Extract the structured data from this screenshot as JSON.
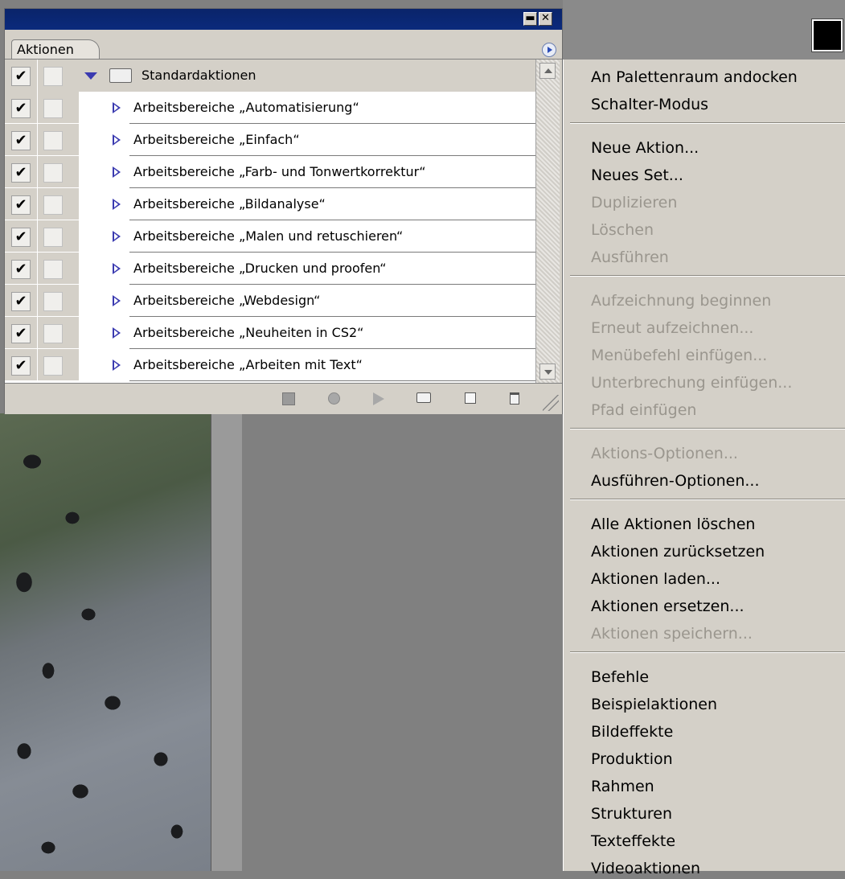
{
  "palette": {
    "tab_label": "Aktionen",
    "set": {
      "name": "Standardaktionen",
      "checked": true
    },
    "actions": [
      {
        "label": "Arbeitsbereiche „Automatisierung“",
        "checked": true
      },
      {
        "label": "Arbeitsbereiche „Einfach“",
        "checked": true
      },
      {
        "label": "Arbeitsbereiche „Farb- und Tonwertkorrektur“",
        "checked": true
      },
      {
        "label": "Arbeitsbereiche „Bildanalyse“",
        "checked": true
      },
      {
        "label": "Arbeitsbereiche „Malen und retuschieren“",
        "checked": true
      },
      {
        "label": "Arbeitsbereiche „Drucken und proofen“",
        "checked": true
      },
      {
        "label": "Arbeitsbereiche „Webdesign“",
        "checked": true
      },
      {
        "label": "Arbeitsbereiche „Neuheiten in CS2“",
        "checked": true
      },
      {
        "label": "Arbeitsbereiche „Arbeiten mit Text“",
        "checked": true
      }
    ],
    "check_glyph": "✔"
  },
  "menu": {
    "groups": [
      [
        {
          "label": "An Palettenraum andocken",
          "enabled": true
        },
        {
          "label": "Schalter-Modus",
          "enabled": true
        }
      ],
      [
        {
          "label": "Neue Aktion...",
          "enabled": true
        },
        {
          "label": "Neues Set...",
          "enabled": true
        },
        {
          "label": "Duplizieren",
          "enabled": false
        },
        {
          "label": "Löschen",
          "enabled": false
        },
        {
          "label": "Ausführen",
          "enabled": false
        }
      ],
      [
        {
          "label": "Aufzeichnung beginnen",
          "enabled": false
        },
        {
          "label": "Erneut aufzeichnen...",
          "enabled": false
        },
        {
          "label": "Menübefehl einfügen...",
          "enabled": false
        },
        {
          "label": "Unterbrechung einfügen...",
          "enabled": false
        },
        {
          "label": "Pfad einfügen",
          "enabled": false
        }
      ],
      [
        {
          "label": "Aktions-Optionen...",
          "enabled": false
        },
        {
          "label": "Ausführen-Optionen...",
          "enabled": true
        }
      ],
      [
        {
          "label": "Alle Aktionen löschen",
          "enabled": true
        },
        {
          "label": "Aktionen zurücksetzen",
          "enabled": true
        },
        {
          "label": "Aktionen laden...",
          "enabled": true
        },
        {
          "label": "Aktionen ersetzen...",
          "enabled": true
        },
        {
          "label": "Aktionen speichern...",
          "enabled": false
        }
      ],
      [
        {
          "label": "Befehle",
          "enabled": true
        },
        {
          "label": "Beispielaktionen",
          "enabled": true
        },
        {
          "label": "Bildeffekte",
          "enabled": true
        },
        {
          "label": "Produktion",
          "enabled": true
        },
        {
          "label": "Rahmen",
          "enabled": true
        },
        {
          "label": "Strukturen",
          "enabled": true
        },
        {
          "label": "Texteffekte",
          "enabled": true
        },
        {
          "label": "Videoaktionen",
          "enabled": true
        }
      ]
    ]
  },
  "colors": {
    "title_bar": "#0a246a",
    "panel": "#d4d0c8",
    "disabled_text": "#9a968e",
    "expand_triangle": "#3a3ab0",
    "foreground_swatch": "#000000"
  }
}
